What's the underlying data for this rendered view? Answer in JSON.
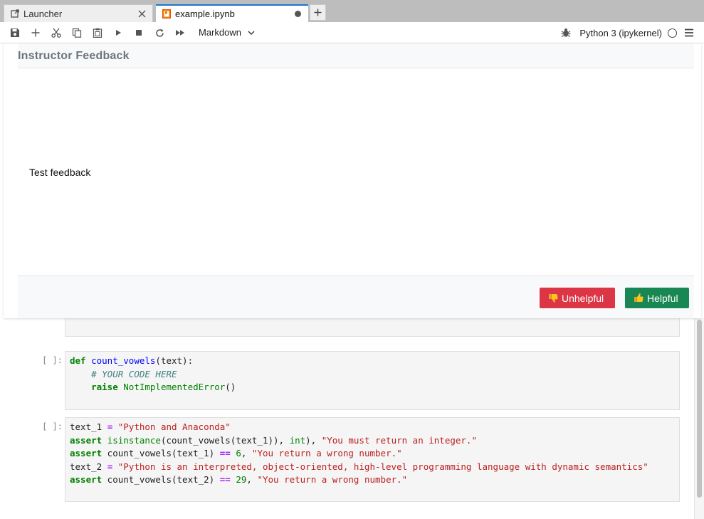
{
  "tabs": [
    {
      "label": "Launcher"
    },
    {
      "label": "example.ipynb"
    }
  ],
  "toolbar": {
    "cell_type": "Markdown",
    "kernel": "Python 3 (ipykernel)"
  },
  "feedback": {
    "title": "Instructor Feedback",
    "body": "Test feedback",
    "unhelpful_label": "Unhelpful",
    "helpful_label": "Helpful"
  },
  "cells": [
    {
      "prompt": "[ ]:"
    },
    {
      "prompt": "[ ]:"
    }
  ],
  "colors": {
    "accent": "#1976d2",
    "unhelpful": "#dc3545",
    "helpful": "#198754"
  },
  "icons": [
    "external-link-icon",
    "notebook-icon",
    "close-icon",
    "dirty-dot-icon",
    "plus-icon",
    "save-icon",
    "cut-icon",
    "copy-icon",
    "paste-icon",
    "run-icon",
    "stop-icon",
    "restart-icon",
    "fast-forward-icon",
    "chevron-down-icon",
    "bug-icon",
    "kernel-status-icon",
    "menu-icon",
    "thumbs-down-icon",
    "thumbs-up-icon"
  ]
}
